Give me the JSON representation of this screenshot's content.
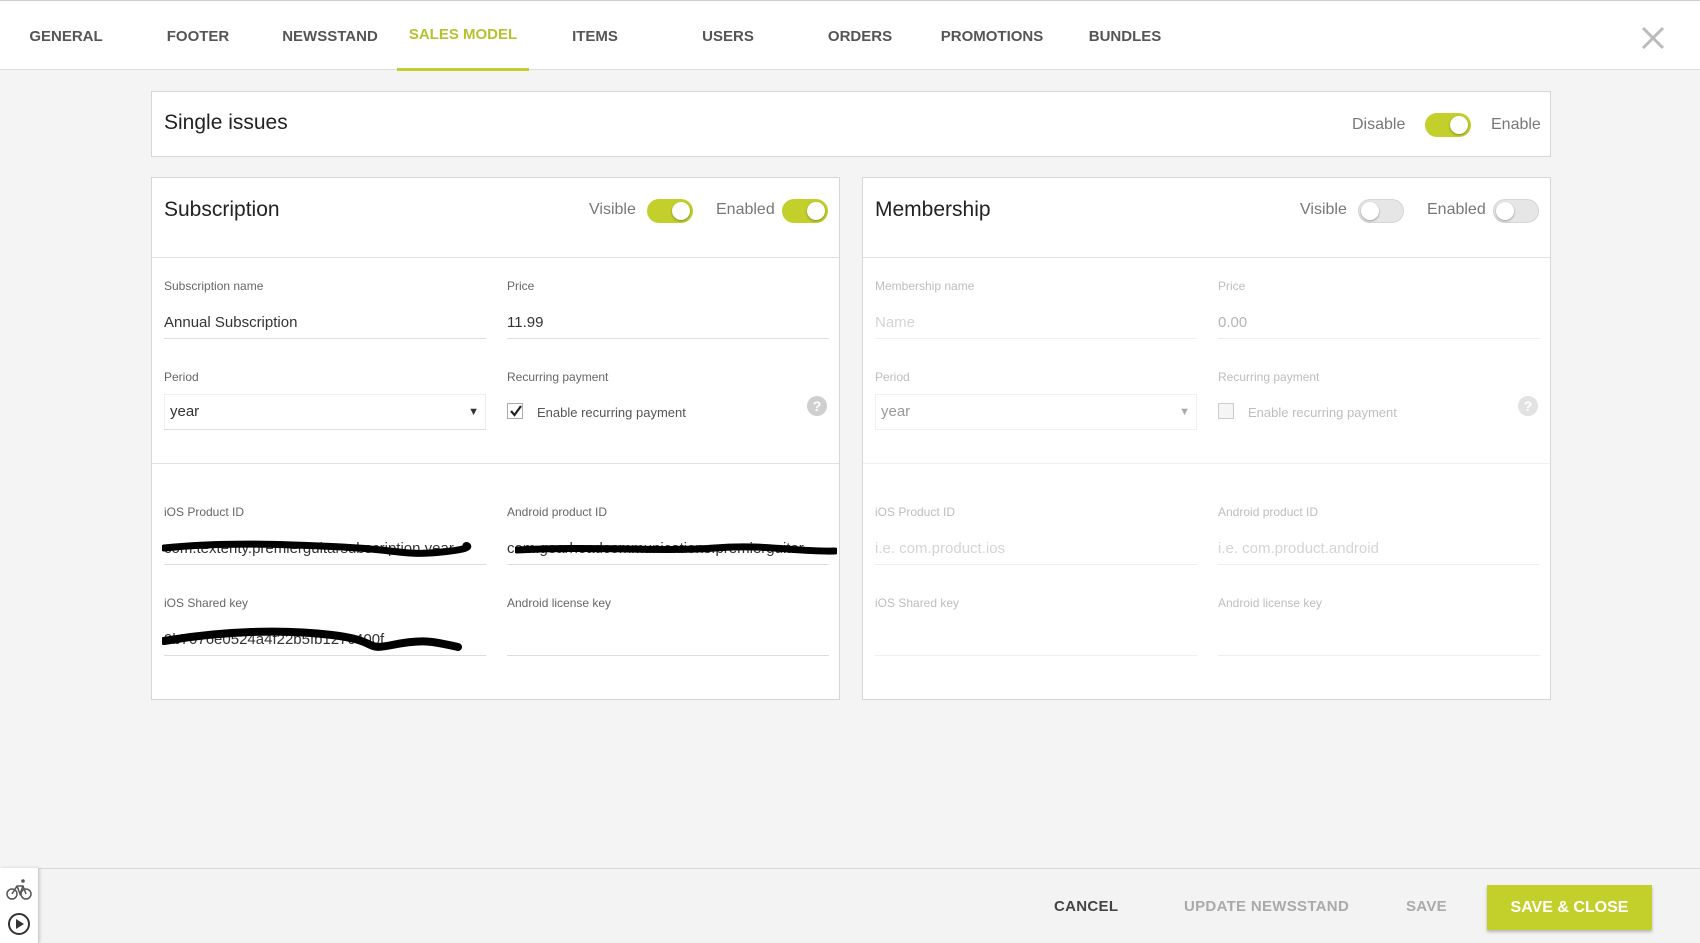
{
  "tabs": [
    {
      "label": "GENERAL",
      "active": false
    },
    {
      "label": "FOOTER",
      "active": false
    },
    {
      "label": "NEWSSTAND",
      "active": false
    },
    {
      "label": "SALES MODEL",
      "active": true
    },
    {
      "label": "ITEMS",
      "active": false
    },
    {
      "label": "USERS",
      "active": false
    },
    {
      "label": "ORDERS",
      "active": false
    },
    {
      "label": "PROMOTIONS",
      "active": false
    },
    {
      "label": "BUNDLES",
      "active": false
    }
  ],
  "single_issues": {
    "title": "Single issues",
    "disable_label": "Disable",
    "enable_label": "Enable",
    "enabled": true
  },
  "subscription": {
    "title": "Subscription",
    "visible_label": "Visible",
    "visible": true,
    "enabled_label": "Enabled",
    "enabled": true,
    "name_label": "Subscription name",
    "name_value": "Annual Subscription",
    "price_label": "Price",
    "price_value": "11.99",
    "period_label": "Period",
    "period_value": "year",
    "recurring_label": "Recurring payment",
    "recurring_checkbox_label": "Enable recurring payment",
    "recurring_checked": true,
    "ios_product_label": "iOS Product ID",
    "ios_product_value": "com.texterity.premierguitarsubscription.year",
    "android_product_label": "Android product ID",
    "android_product_value": "com.gearheadcommunications.premierguitar",
    "ios_shared_label": "iOS Shared key",
    "ios_shared_value": "9b7076e0524a4f22b5fb127c400f",
    "android_license_label": "Android license key",
    "android_license_value": ""
  },
  "membership": {
    "title": "Membership",
    "visible_label": "Visible",
    "visible": false,
    "enabled_label": "Enabled",
    "enabled": false,
    "name_label": "Membership name",
    "name_placeholder": "Name",
    "price_label": "Price",
    "price_value": "0.00",
    "period_label": "Period",
    "period_value": "year",
    "recurring_label": "Recurring payment",
    "recurring_checkbox_label": "Enable recurring payment",
    "recurring_checked": false,
    "ios_product_label": "iOS Product ID",
    "ios_product_placeholder": "i.e. com.product.ios",
    "android_product_label": "Android product ID",
    "android_product_placeholder": "i.e. com.product.android",
    "ios_shared_label": "iOS Shared key",
    "android_license_label": "Android license key"
  },
  "footer": {
    "cancel": "CANCEL",
    "update_newsstand": "UPDATE NEWSSTAND",
    "save": "SAVE",
    "save_close": "SAVE & CLOSE"
  },
  "colors": {
    "accent": "#c3cf2b",
    "accent_text": "#b5c22e",
    "disabled_text": "#bdbdbd"
  },
  "icons": {
    "close": "close-icon",
    "help": "help-icon",
    "bike": "bike-icon",
    "play": "play-icon"
  }
}
